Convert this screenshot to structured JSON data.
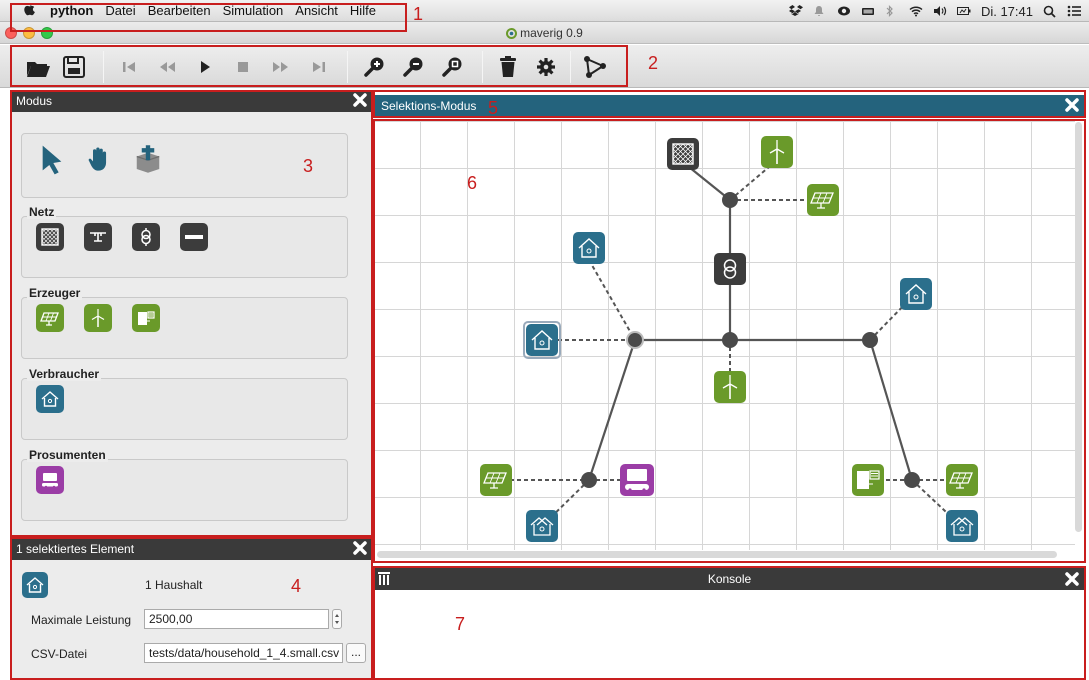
{
  "menubar": {
    "app_name": "python",
    "items": [
      "Datei",
      "Bearbeiten",
      "Simulation",
      "Ansicht",
      "Hilfe"
    ],
    "clock": "Di. 17:41"
  },
  "window": {
    "title": "maverig 0.9"
  },
  "toolbar": {
    "buttons": [
      "folder-open",
      "save",
      "skip-to-start",
      "rewind",
      "play",
      "stop",
      "fast-forward",
      "skip-to-end",
      "zoom-in",
      "zoom-out",
      "zoom-fit",
      "delete",
      "settings",
      "graph"
    ]
  },
  "annotations": [
    "1",
    "2",
    "3",
    "4",
    "5",
    "6",
    "7"
  ],
  "mode_panel": {
    "title": "Modus",
    "groups": {
      "net": "Netz",
      "producers": "Erzeuger",
      "consumers": "Verbraucher",
      "prosumers": "Prosumenten"
    }
  },
  "selection_mode": {
    "title": "Selektions-Modus"
  },
  "properties_panel": {
    "title": "1 selektiertes Element",
    "element_name": "1 Haushalt",
    "max_power_label": "Maximale Leistung",
    "max_power_value": "2500,00",
    "csv_label": "CSV-Datei",
    "csv_value": "tests/data/household_1_4.small.csv",
    "browse_label": "..."
  },
  "console": {
    "title": "Konsole"
  },
  "colors": {
    "consumer": "#2b6f8c",
    "producer": "#6a9a2a",
    "prosumer": "#9b3da6",
    "net": "#3c3c3c",
    "annotation": "#c81e1e",
    "header_blue": "#24637d"
  }
}
